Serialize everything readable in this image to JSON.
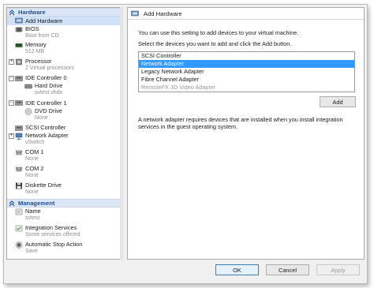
{
  "sidebar": {
    "sections": {
      "hardware": "Hardware",
      "management": "Management"
    },
    "items": [
      {
        "label": "Add Hardware",
        "sub": ""
      },
      {
        "label": "BIOS",
        "sub": "Boot from CD"
      },
      {
        "label": "Memory",
        "sub": "512 MB"
      },
      {
        "label": "Processor",
        "sub": "2 Virtual processors"
      },
      {
        "label": "IDE Controller 0",
        "sub": ""
      },
      {
        "label": "Hard Drive",
        "sub": "svtest.vhdx"
      },
      {
        "label": "IDE Controller 1",
        "sub": ""
      },
      {
        "label": "DVD Drive",
        "sub": "None"
      },
      {
        "label": "SCSI Controller",
        "sub": ""
      },
      {
        "label": "Network Adapter",
        "sub": "vSwitch"
      },
      {
        "label": "COM 1",
        "sub": "None"
      },
      {
        "label": "COM 2",
        "sub": "None"
      },
      {
        "label": "Diskette Drive",
        "sub": "None"
      },
      {
        "label": "Name",
        "sub": "svtest"
      },
      {
        "label": "Integration Services",
        "sub": "Some services offered"
      },
      {
        "label": "Automatic Stop Action",
        "sub": "Save"
      }
    ]
  },
  "main": {
    "title": "Add Hardware",
    "intro1": "You can use this setting to add devices to your virtual machine.",
    "intro2": "Select the devices you want to add and click the Add button.",
    "devices": [
      {
        "label": "SCSI Controller"
      },
      {
        "label": "Network Adapter"
      },
      {
        "label": "Legacy Network Adapter"
      },
      {
        "label": "Fibre Channel Adapter"
      },
      {
        "label": "RemoteFX 3D Video Adapter"
      }
    ],
    "selected_device": "Network Adapter",
    "add_label": "Add",
    "description_line1": "A network adapter requires devices that are installed when you install integration",
    "description_line2": "services in the guest operating system."
  },
  "footer": {
    "ok_label": "OK",
    "cancel_label": "Cancel",
    "apply_label": "Apply"
  },
  "colors": {
    "section_bg": "#dbe7f6",
    "section_text": "#1d4f8c",
    "selection": "#3399ff",
    "tree_selection": "#cfe2f7"
  }
}
